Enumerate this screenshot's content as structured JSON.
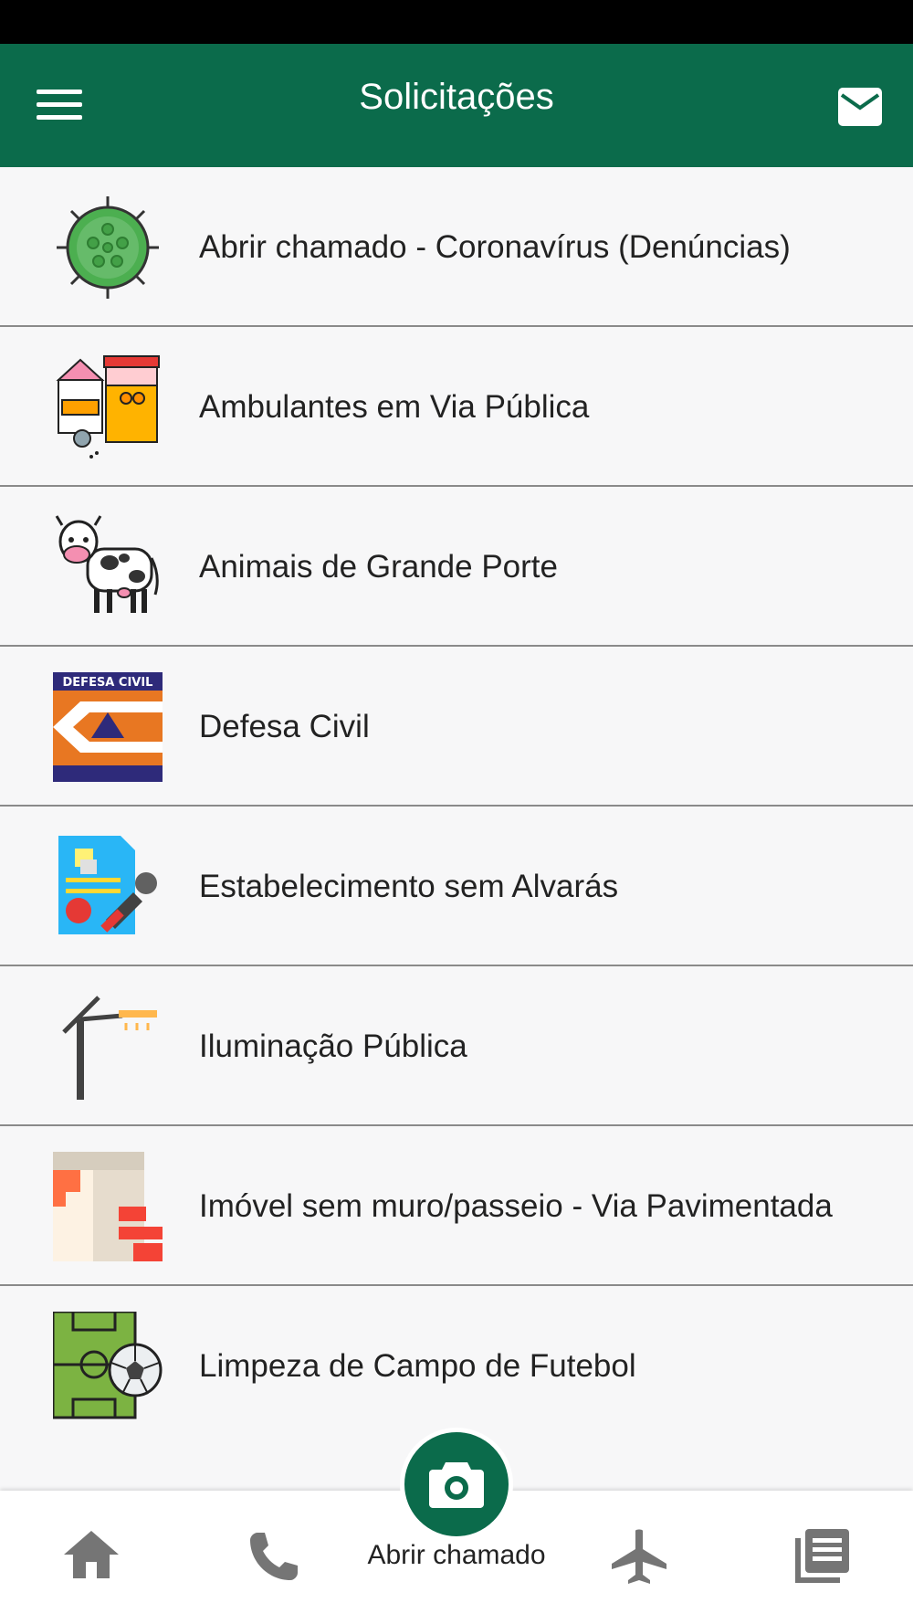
{
  "header": {
    "title": "Solicitações"
  },
  "items": [
    {
      "label": "Abrir chamado - Coronavírus (Denúncias)",
      "icon": "coronavirus-icon"
    },
    {
      "label": "Ambulantes em Via Pública",
      "icon": "street-vendor-icon"
    },
    {
      "label": "Animais de Grande Porte",
      "icon": "cow-icon"
    },
    {
      "label": "Defesa Civil",
      "icon": "defesa-civil-logo",
      "logo_text": "DEFESA CIVIL"
    },
    {
      "label": "Estabelecimento sem Alvarás",
      "icon": "document-stamp-icon"
    },
    {
      "label": "Iluminação Pública",
      "icon": "street-lamp-icon"
    },
    {
      "label": "Imóvel sem muro/passeio - Via Pavimentada",
      "icon": "wall-icon"
    },
    {
      "label": "Limpeza de Campo de Futebol",
      "icon": "soccer-field-icon"
    }
  ],
  "bottom_nav": {
    "fab_label": "Abrir chamado",
    "items": [
      {
        "icon": "home-icon"
      },
      {
        "icon": "phone-icon"
      },
      {
        "icon": "camera-icon"
      },
      {
        "icon": "airplane-icon"
      },
      {
        "icon": "news-icon"
      }
    ]
  },
  "colors": {
    "primary": "#0b6b4b",
    "background": "#f7f7f8",
    "divider": "#8a8a8a",
    "nav_icon": "#757575"
  }
}
